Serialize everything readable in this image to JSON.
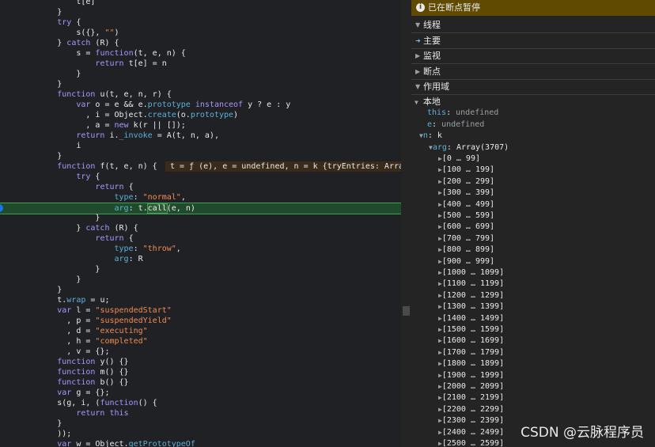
{
  "code": {
    "lines": [
      {
        "t": "                t[e]"
      },
      {
        "t": "            }"
      },
      {
        "h": "            <span class='kw'>try</span> {"
      },
      {
        "h": "                s({}, <span class='str'>\"\"</span>)"
      },
      {
        "h": "            } <span class='kw'>catch</span> (R) {"
      },
      {
        "h": "                s = <span class='kw'>function</span>(t, e, n) {"
      },
      {
        "h": "                    <span class='kw'>return</span> t[e] = n"
      },
      {
        "t": "                }"
      },
      {
        "t": "            }"
      },
      {
        "h": "            <span class='kw'>function</span> u(t, e, n, r) {"
      },
      {
        "h": "                <span class='kw'>var</span> o = e &amp;&amp; e.<span class='prop'>prototype</span> <span class='kw'>instanceof</span> y ? e : y"
      },
      {
        "h": "                  , i = Object.<span class='prop'>create</span>(o.<span class='prop'>prototype</span>)"
      },
      {
        "h": "                  , a = <span class='kw'>new</span> k(r || []);"
      },
      {
        "h": "                <span class='kw'>return</span> i.<span class='prop'>_invoke</span> = A(t, n, a),"
      },
      {
        "t": "                i"
      },
      {
        "t": "            }"
      },
      {
        "h": "            <span class='kw'>function</span> f(t, e, n) {"
      },
      {
        "h": "                <span class='kw'>try</span> {"
      },
      {
        "h": "                    <span class='kw'>return</span> {"
      },
      {
        "h": "                        <span class='prop'>type</span>: <span class='str'>\"normal\"</span>,"
      },
      {
        "h": "                        <span class='prop'>arg</span>: t.<span class='call'>call</span>(e, n)"
      },
      {
        "t": "                    }"
      },
      {
        "h": "                } <span class='kw'>catch</span> (R) {"
      },
      {
        "h": "                    <span class='kw'>return</span> {"
      },
      {
        "h": "                        <span class='prop'>type</span>: <span class='str'>\"throw\"</span>,"
      },
      {
        "h": "                        <span class='prop'>arg</span>: R"
      },
      {
        "t": "                    }"
      },
      {
        "t": "                }"
      },
      {
        "t": "            }"
      },
      {
        "h": "            t.<span class='prop'>wrap</span> = u;"
      },
      {
        "h": "            <span class='kw'>var</span> l = <span class='str'>\"suspendedStart\"</span>"
      },
      {
        "h": "              , p = <span class='str'>\"suspendedYield\"</span>"
      },
      {
        "h": "              , d = <span class='str'>\"executing\"</span>"
      },
      {
        "h": "              , h = <span class='str'>\"completed\"</span>"
      },
      {
        "t": "              , v = {};"
      },
      {
        "h": "            <span class='kw'>function</span> y() {}"
      },
      {
        "h": "            <span class='kw'>function</span> m() {}"
      },
      {
        "h": "            <span class='kw'>function</span> b() {}"
      },
      {
        "h": "            <span class='kw'>var</span> g = {};"
      },
      {
        "h": "            s(g, i, (<span class='kw'>function</span>() {"
      },
      {
        "h": "                <span class='kw'>return</span> <span class='kw'>this</span>"
      },
      {
        "t": "            }"
      },
      {
        "t": "            ));"
      },
      {
        "h": "            <span class='kw'>var</span> w = Object.<span class='prop'>getPrototypeOf</span>"
      }
    ],
    "inline_value": "t = ƒ (e), e = undefined, n = k {tryEntries: Arra",
    "highlight_line": 20
  },
  "panel": {
    "banner": "已在断点暂停",
    "sections": [
      {
        "label": "线程",
        "open": true
      },
      {
        "label": "主要",
        "active": true
      },
      {
        "label": "监视",
        "open": false
      },
      {
        "label": "断点",
        "open": false
      },
      {
        "label": "作用域",
        "open": true
      }
    ],
    "scope": {
      "local_label": "本地",
      "vars": [
        {
          "name": "this",
          "value": "undefined"
        },
        {
          "name": "e",
          "value": "undefined"
        }
      ],
      "n_label": "n",
      "n_value": "k",
      "arg_label": "arg",
      "arg_value": "Array(3707)",
      "ranges": [
        "[0 … 99]",
        "[100 … 199]",
        "[200 … 299]",
        "[300 … 399]",
        "[400 … 499]",
        "[500 … 599]",
        "[600 … 699]",
        "[700 … 799]",
        "[800 … 899]",
        "[900 … 999]",
        "[1000 … 1099]",
        "[1100 … 1199]",
        "[1200 … 1299]",
        "[1300 … 1399]",
        "[1400 … 1499]",
        "[1500 … 1599]",
        "[1600 … 1699]",
        "[1700 … 1799]",
        "[1800 … 1899]",
        "[1900 … 1999]",
        "[2000 … 2099]",
        "[2100 … 2199]",
        "[2200 … 2299]",
        "[2300 … 2399]",
        "[2400 … 2499]",
        "[2500 … 2599]"
      ]
    },
    "watermark": "CSDN @云脉程序员"
  }
}
